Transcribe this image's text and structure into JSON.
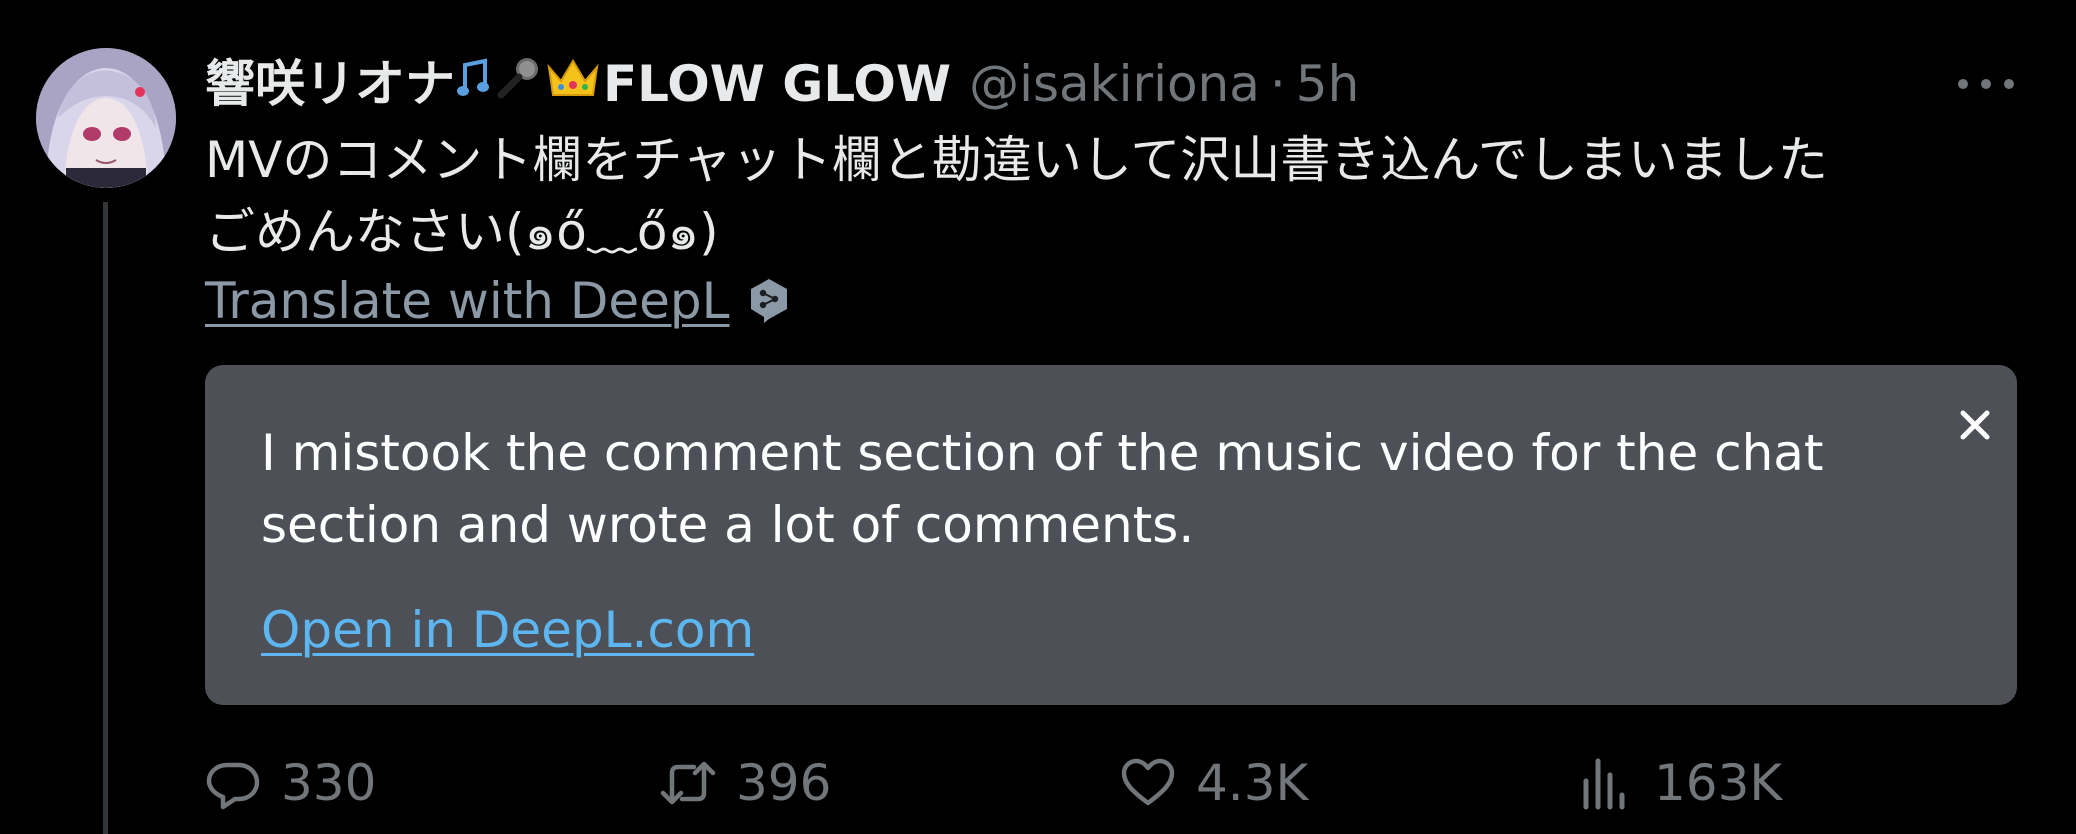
{
  "tweet": {
    "display_name": "響咲リオナ",
    "display_name_suffix": "FLOW GLOW",
    "handle": "@isakiriona",
    "separator": "·",
    "time": "5h",
    "text_line1": "MVのコメント欄をチャット欄と勘違いして沢山書き込んでしまいました",
    "text_line2": "ごめんなさい(๑ő﹏ő๑)",
    "translate_link": "Translate with DeepL"
  },
  "translation": {
    "text": "I mistook the comment section of the music video for the chat section and wrote a lot of comments.",
    "open_link": "Open in DeepL.com"
  },
  "actions": {
    "replies": "330",
    "retweets": "396",
    "likes": "4.3K",
    "views": "163K"
  },
  "icons": {
    "more": "more-horizontal-icon",
    "close": "close-icon",
    "reply": "reply-icon",
    "retweet": "retweet-icon",
    "like": "heart-icon",
    "views": "analytics-icon",
    "deepl": "deepl-logo-icon",
    "emoji1": "musical-notes-emoji",
    "emoji2": "microphone-emoji",
    "emoji3": "crown-emoji"
  },
  "colors": {
    "background": "#000000",
    "text_primary": "#e7e9ea",
    "text_secondary": "#71767b",
    "translation_bg": "#4d5157",
    "link_blue": "#5db6f0"
  }
}
